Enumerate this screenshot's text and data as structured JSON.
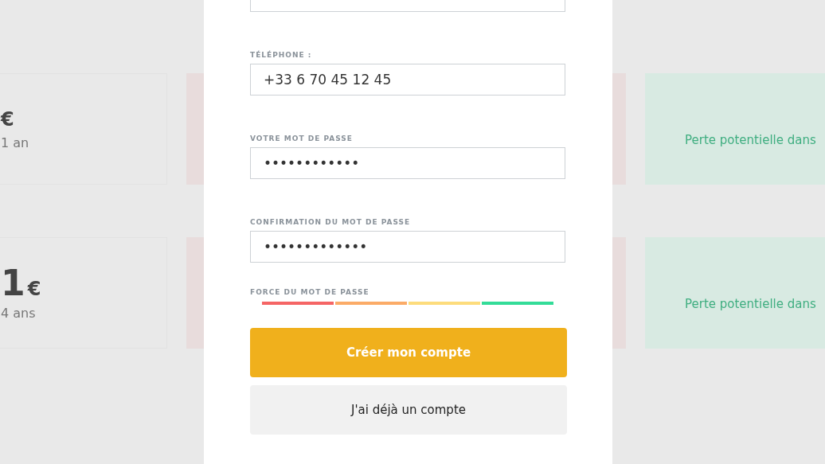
{
  "background": {
    "rows": [
      {
        "currency": "€",
        "period": "1 an",
        "note": "Perte potentielle dans"
      },
      {
        "amount": "1",
        "currency": "€",
        "period": "4 ans",
        "note": "Perte potentielle dans"
      }
    ]
  },
  "form": {
    "fields": [
      {
        "kind": "cut"
      },
      {
        "label": "TÉLÉPHONE :",
        "value": "+33 6 70 45 12 45"
      },
      {
        "label": "VOTRE MOT DE PASSE",
        "value": "••••••••••••"
      },
      {
        "label": "CONFIRMATION DU MOT DE PASSE",
        "value": "•••••••••••••"
      }
    ],
    "strength": {
      "label": "FORCE DU MOT DE PASSE",
      "segments": [
        {
          "color": "#f56565"
        },
        {
          "color": "#fbab67"
        },
        {
          "color": "#fddc7c"
        },
        {
          "color": "#33dc98"
        }
      ]
    },
    "buttons": [
      {
        "label": "Créer mon compte",
        "kind": "primary"
      },
      {
        "label": "J'ai déjà un compte",
        "kind": "secondary"
      }
    ]
  }
}
